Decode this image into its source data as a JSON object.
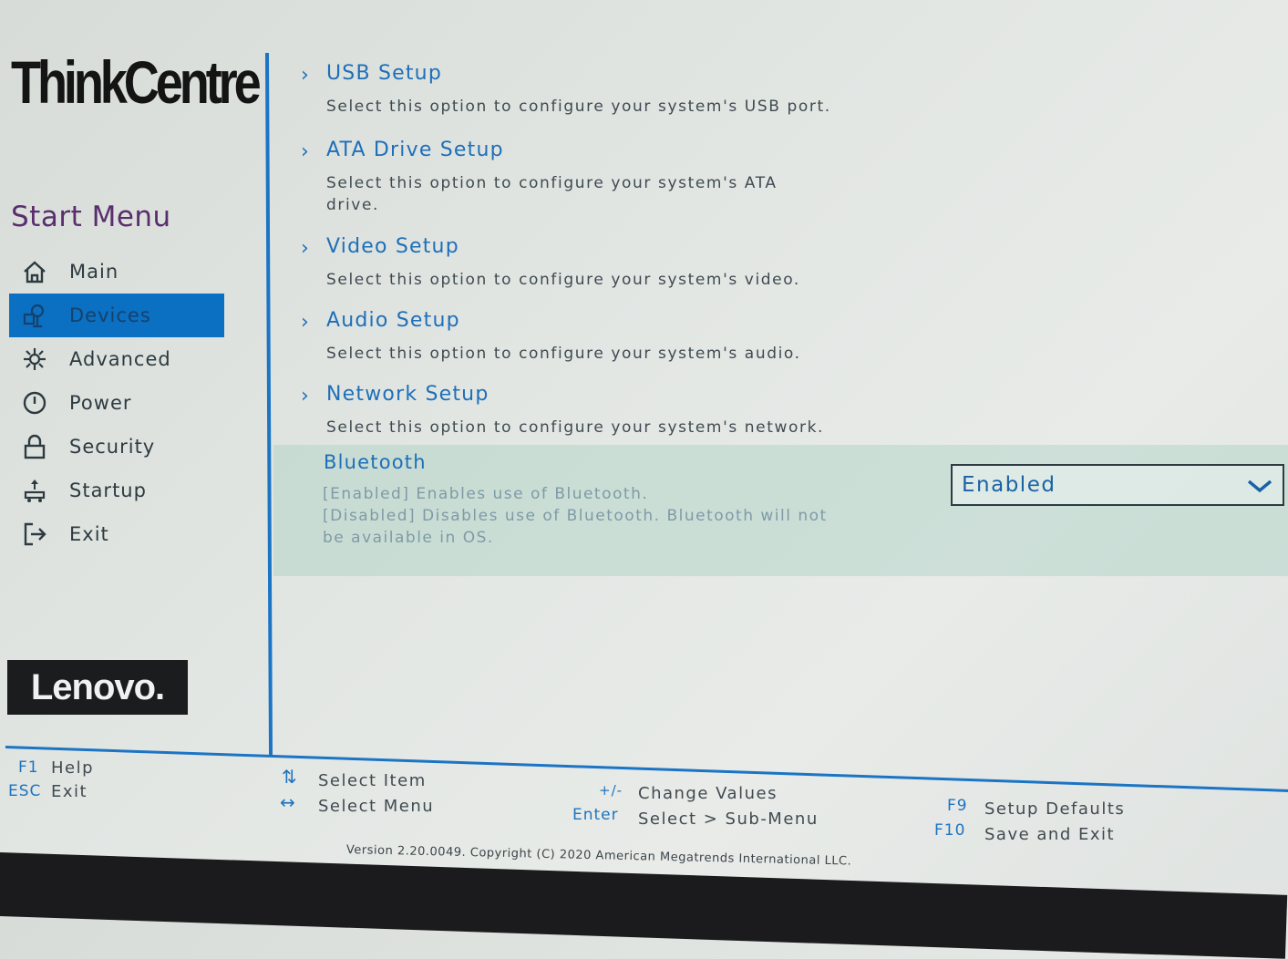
{
  "brand": {
    "product_logo": "ThinkCentre",
    "vendor_logo": "Lenovo."
  },
  "sidebar": {
    "heading": "Start Menu",
    "items": [
      {
        "label": "Main",
        "icon": "home-icon"
      },
      {
        "label": "Devices",
        "icon": "devices-icon",
        "active": true
      },
      {
        "label": "Advanced",
        "icon": "advanced-icon"
      },
      {
        "label": "Power",
        "icon": "power-icon"
      },
      {
        "label": "Security",
        "icon": "lock-icon"
      },
      {
        "label": "Startup",
        "icon": "startup-icon"
      },
      {
        "label": "Exit",
        "icon": "exit-icon"
      }
    ]
  },
  "main": {
    "entries": [
      {
        "title": "USB Setup",
        "description": "Select this option to configure your system's USB port."
      },
      {
        "title": "ATA Drive Setup",
        "description": "Select this option to configure your system's ATA drive."
      },
      {
        "title": "Video Setup",
        "description": "Select this option to configure your system's video."
      },
      {
        "title": "Audio Setup",
        "description": "Select this option to configure your system's audio."
      },
      {
        "title": "Network Setup",
        "description": "Select this option to configure your system's network."
      }
    ],
    "bluetooth": {
      "title": "Bluetooth",
      "desc_enabled": "[Enabled] Enables use of Bluetooth.",
      "desc_disabled": "[Disabled] Disables use of Bluetooth. Bluetooth will not be available in OS.",
      "value": "Enabled"
    }
  },
  "footer": {
    "f1_key": "F1",
    "f1_label": "Help",
    "esc_key": "ESC",
    "esc_label": "Exit",
    "select_item": "Select Item",
    "select_menu": "Select Menu",
    "plusminus_key": "+/-",
    "change_values": "Change Values",
    "enter_key": "Enter",
    "enter_label": "Select > Sub-Menu",
    "f9_key": "F9",
    "f9_label": "Setup Defaults",
    "f10_key": "F10",
    "f10_label": "Save and Exit",
    "version": "Version 2.20.0049. Copyright (C) 2020 American Megatrends International LLC."
  },
  "colors": {
    "accent": "#1e6fb8",
    "active_bg": "#0b6fc2",
    "heading": "#5a2e6e"
  }
}
